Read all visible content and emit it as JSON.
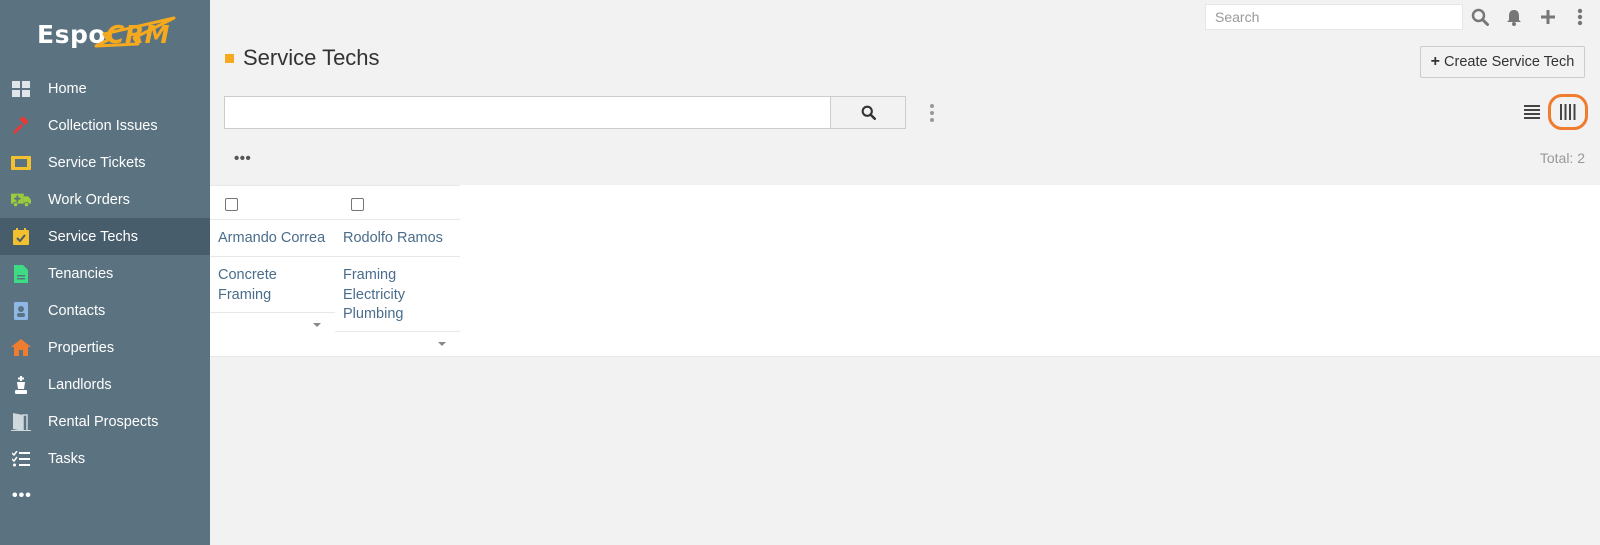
{
  "app": {
    "logo_text_a": "Espo",
    "logo_text_b": "CRM",
    "brand_color": "#f4a91e",
    "sidebar_color": "#5b7280",
    "active_color": "#475d6b"
  },
  "sidebar": {
    "items": [
      {
        "label": "Home",
        "icon": "home-grid-icon",
        "color": "#e8e8e8"
      },
      {
        "label": "Collection Issues",
        "icon": "gavel-icon",
        "color": "#e53935"
      },
      {
        "label": "Service Tickets",
        "icon": "ticket-icon",
        "color": "#f4c12e"
      },
      {
        "label": "Work Orders",
        "icon": "truck-medical-icon",
        "color": "#9ccc3c"
      },
      {
        "label": "Service Techs",
        "icon": "calendar-check-icon",
        "color": "#f4c12e"
      },
      {
        "label": "Tenancies",
        "icon": "document-icon",
        "color": "#3ddc84"
      },
      {
        "label": "Contacts",
        "icon": "contact-card-icon",
        "color": "#8fb8e6"
      },
      {
        "label": "Properties",
        "icon": "house-icon",
        "color": "#ee7d2f"
      },
      {
        "label": "Landlords",
        "icon": "chess-king-icon",
        "color": "#ffffff"
      },
      {
        "label": "Rental Prospects",
        "icon": "door-open-icon",
        "color": "#cfd8dc"
      },
      {
        "label": "Tasks",
        "icon": "tasks-icon",
        "color": "#ffffff"
      }
    ],
    "more_label": "•••"
  },
  "topbar": {
    "search_placeholder": "Search"
  },
  "header": {
    "title": "Service Techs",
    "create_label": "Create Service Tech"
  },
  "list": {
    "actions_label": "•••",
    "total_label": "Total: 2"
  },
  "kanban": {
    "accent": "#ee7d2f",
    "columns": [
      {
        "name": "Armando Correa",
        "skills": [
          "Concrete",
          "Framing"
        ]
      },
      {
        "name": "Rodolfo Ramos",
        "skills": [
          "Framing",
          "Electricity",
          "Plumbing"
        ]
      }
    ]
  }
}
